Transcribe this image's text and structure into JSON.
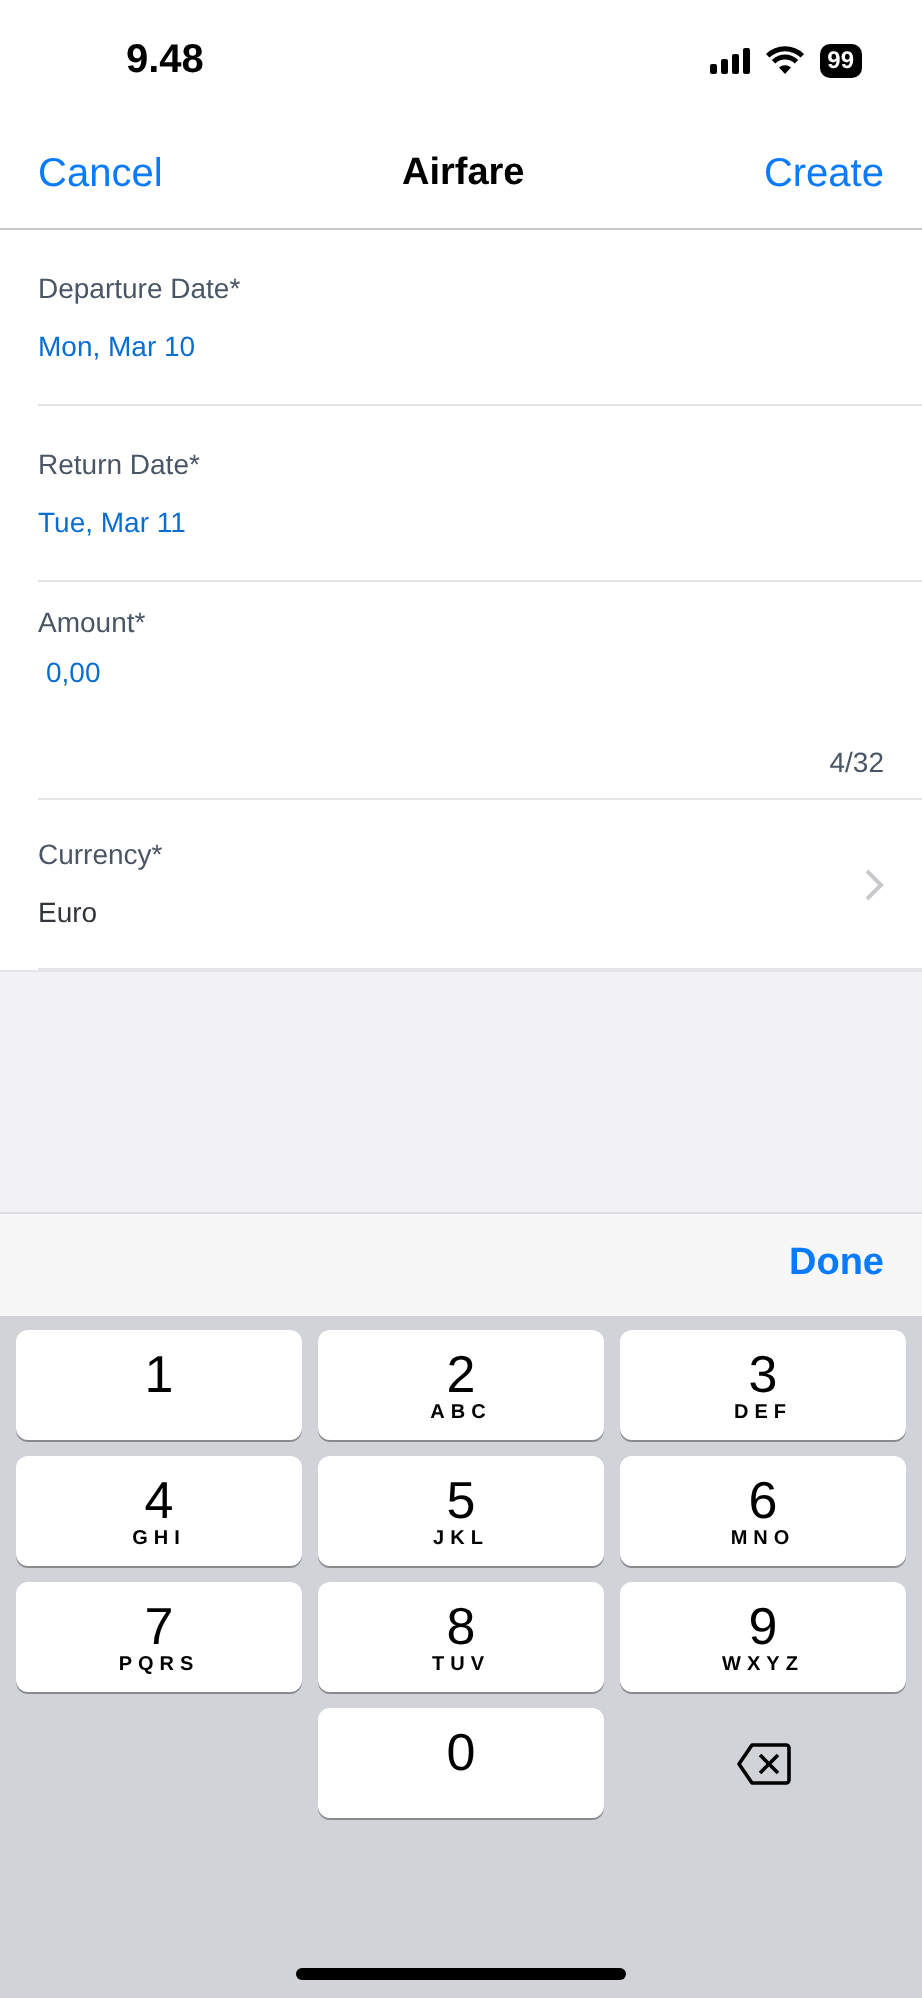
{
  "status_bar": {
    "time": "9.48",
    "battery": "99"
  },
  "nav": {
    "cancel": "Cancel",
    "title": "Airfare",
    "create": "Create"
  },
  "fields": [
    {
      "kind": "date",
      "label": "Departure Date*",
      "value": "Mon, Mar 10"
    },
    {
      "kind": "date",
      "label": "Return Date*",
      "value": "Tue, Mar 11"
    },
    {
      "kind": "input",
      "label": "Amount*",
      "value": "0,00",
      "counter": "4/32"
    },
    {
      "kind": "select",
      "label": "Currency*",
      "value": "Euro"
    }
  ],
  "toolbar": {
    "done": "Done"
  },
  "keypad": [
    {
      "kind": "digit",
      "digit": "1"
    },
    {
      "kind": "digit",
      "digit": "2",
      "letters": "ABC"
    },
    {
      "kind": "digit",
      "digit": "3",
      "letters": "DEF"
    },
    {
      "kind": "digit",
      "digit": "4",
      "letters": "GHI"
    },
    {
      "kind": "digit",
      "digit": "5",
      "letters": "JKL"
    },
    {
      "kind": "digit",
      "digit": "6",
      "letters": "MNO"
    },
    {
      "kind": "digit",
      "digit": "7",
      "letters": "PQRS"
    },
    {
      "kind": "digit",
      "digit": "8",
      "letters": "TUV"
    },
    {
      "kind": "digit",
      "digit": "9",
      "letters": "WXYZ"
    },
    {
      "kind": "digit",
      "digit": "0"
    },
    {
      "kind": "delete"
    }
  ]
}
